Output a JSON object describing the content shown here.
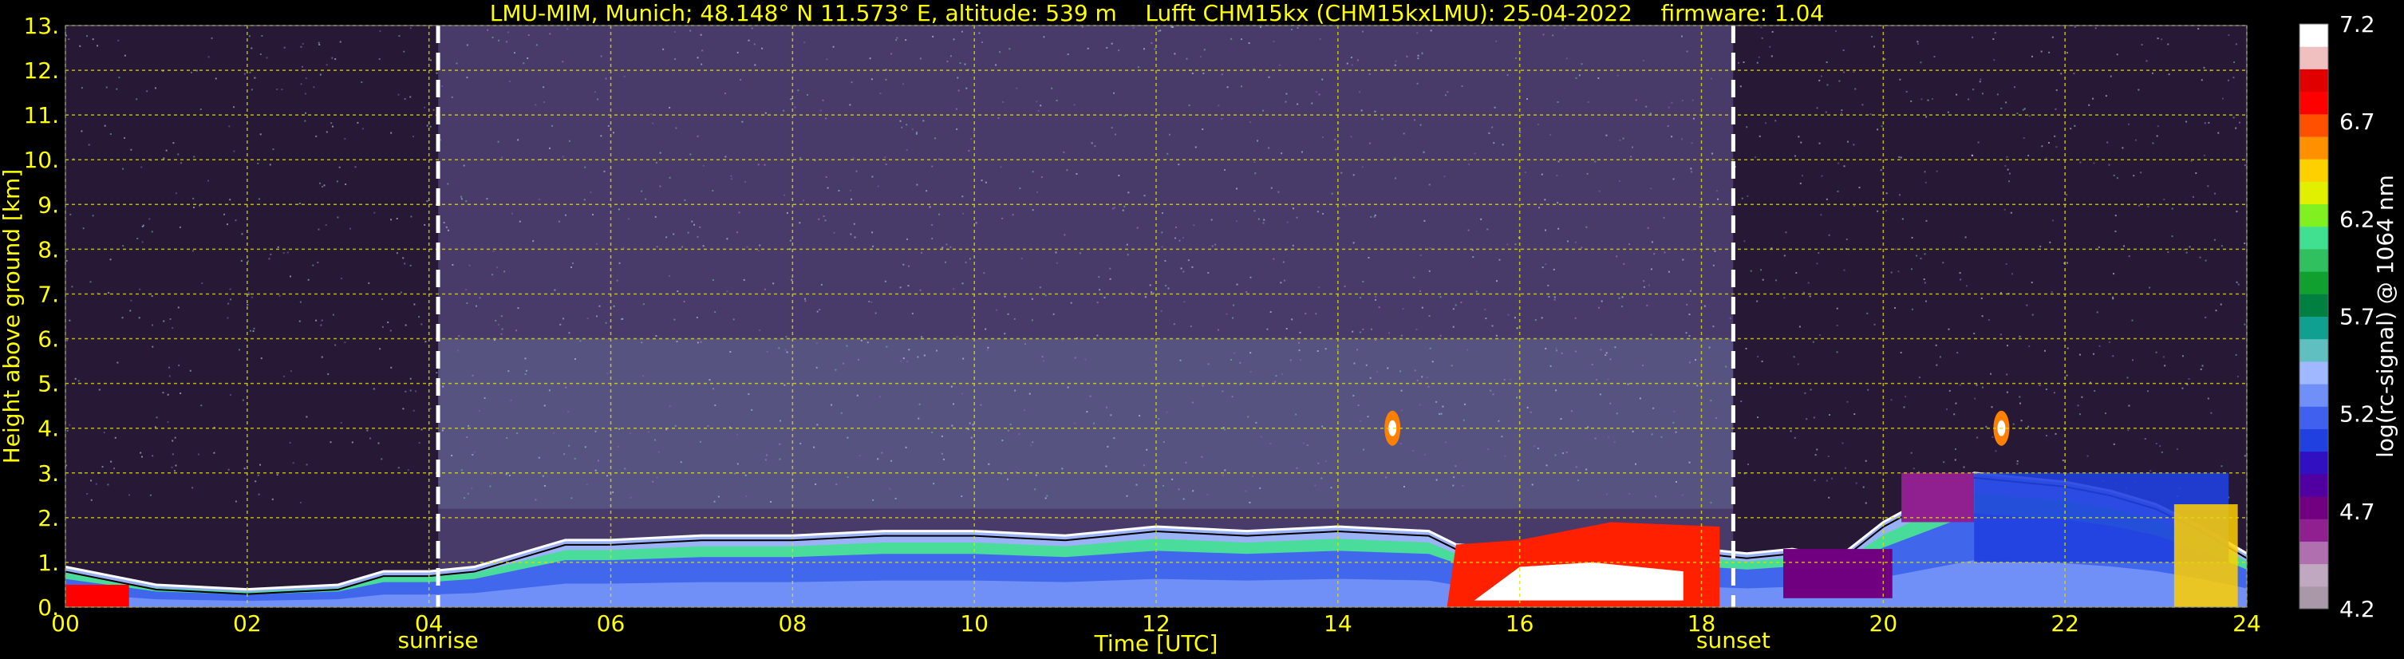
{
  "chart_data": {
    "type": "heatmap",
    "title": "LMU-MIM, Munich; 48.148° N 11.573° E, altitude: 539 m    Lufft CHM15kx (CHM15kxLMU): 25-04-2022    firmware: 1.04",
    "xlabel": "Time [UTC]",
    "ylabel": "Height above ground [km]",
    "colorbar_label": "log(rc-signal) @ 1064 nm",
    "xlim": [
      0,
      24
    ],
    "ylim": [
      0,
      13
    ],
    "x_ticks": [
      "00",
      "02",
      "04",
      "06",
      "08",
      "10",
      "12",
      "14",
      "16",
      "18",
      "20",
      "22",
      "24"
    ],
    "y_ticks": [
      "0.",
      "1.",
      "2.",
      "3.",
      "4.",
      "5.",
      "6.",
      "7.",
      "8.",
      "9.",
      "10.",
      "11.",
      "12.",
      "13."
    ],
    "colorbar_range": [
      4.2,
      7.2
    ],
    "colorbar_ticks": [
      "4.2",
      "4.7",
      "5.2",
      "5.7",
      "6.2",
      "6.7",
      "7.2"
    ],
    "grid": true,
    "sunrise": {
      "label": "sunrise",
      "time": 4.1
    },
    "sunset": {
      "label": "sunset",
      "time": 18.35
    },
    "colormap": [
      "#a898a8",
      "#c0a8c0",
      "#b070b0",
      "#902090",
      "#700080",
      "#5000a0",
      "#3010c0",
      "#2040e0",
      "#4060f0",
      "#7090f8",
      "#a0b8ff",
      "#60c0c0",
      "#10a090",
      "#008040",
      "#10a030",
      "#30c060",
      "#40e090",
      "#80f020",
      "#e0f000",
      "#ffd000",
      "#ff9000",
      "#ff5000",
      "#ff0000",
      "#e00000",
      "#f0c0c0",
      "#ffffff"
    ],
    "boundary_layer_top_km": [
      [
        0.0,
        0.9
      ],
      [
        1.0,
        0.5
      ],
      [
        2.0,
        0.4
      ],
      [
        3.0,
        0.5
      ],
      [
        3.5,
        0.8
      ],
      [
        4.0,
        0.8
      ],
      [
        4.5,
        0.9
      ],
      [
        5.0,
        1.2
      ],
      [
        5.5,
        1.5
      ],
      [
        6.0,
        1.5
      ],
      [
        7.0,
        1.6
      ],
      [
        8.0,
        1.6
      ],
      [
        9.0,
        1.7
      ],
      [
        10.0,
        1.7
      ],
      [
        11.0,
        1.6
      ],
      [
        12.0,
        1.8
      ],
      [
        13.0,
        1.7
      ],
      [
        14.0,
        1.8
      ],
      [
        15.0,
        1.7
      ],
      [
        15.3,
        1.4
      ],
      [
        16.0,
        1.3
      ],
      [
        17.0,
        1.4
      ],
      [
        18.0,
        1.3
      ],
      [
        18.5,
        1.2
      ],
      [
        19.0,
        1.3
      ],
      [
        19.5,
        1.1
      ],
      [
        20.0,
        1.9
      ],
      [
        21.0,
        3.0
      ],
      [
        22.0,
        2.8
      ],
      [
        22.5,
        2.6
      ],
      [
        23.0,
        2.3
      ],
      [
        23.5,
        1.8
      ],
      [
        24.0,
        1.2
      ]
    ],
    "cloud_events": [
      {
        "time": 14.6,
        "height_km": 4.0
      },
      {
        "time": 21.3,
        "height_km": 4.0
      }
    ]
  }
}
